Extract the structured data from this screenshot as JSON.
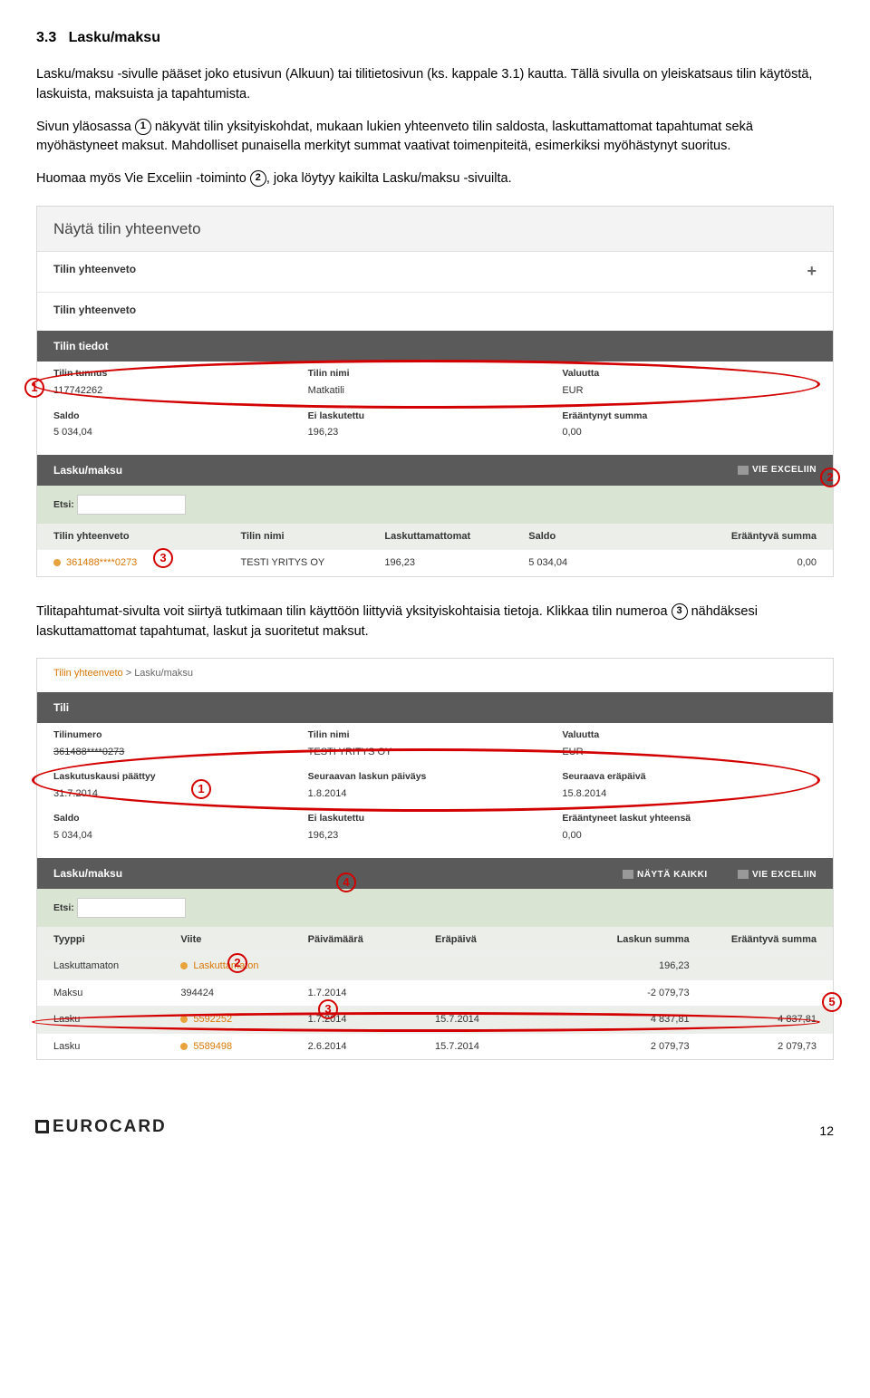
{
  "section": {
    "number": "3.3",
    "title": "Lasku/maksu"
  },
  "para1": "Lasku/maksu -sivulle pääset joko etusivun (Alkuun) tai tilitietosivun (ks. kappale 3.1) kautta. Tällä sivulla on yleiskatsaus tilin käytöstä, laskuista, maksuista ja tapahtumista.",
  "para2a": "Sivun yläosassa ",
  "para2b": " näkyvät tilin yksityiskohdat, mukaan lukien yhteenveto tilin saldosta, laskuttamattomat tapahtumat sekä myöhästyneet maksut. Mahdolliset punaisella merkityt summat vaativat toimenpiteitä, esimerkiksi myöhästynyt suoritus.",
  "para3a": "Huomaa myös Vie Exceliin -toiminto ",
  "para3b": ", joka löytyy kaikilta Lasku/maksu -sivuilta.",
  "panel1": {
    "title": "Näytä tilin yhteenveto",
    "sub1": "Tilin yhteenveto",
    "sub2": "Tilin yhteenveto",
    "darkbar": "Tilin tiedot",
    "r1": {
      "c1l": "Tilin tunnus",
      "c1v": "117742262",
      "c2l": "Tilin nimi",
      "c2v": "Matkatili",
      "c3l": "Valuutta",
      "c3v": "EUR"
    },
    "r2": {
      "c1l": "Saldo",
      "c1v": "5 034,04",
      "c2l": "Ei laskutettu",
      "c2v": "196,23",
      "c3l": "Erääntynyt summa",
      "c3v": "0,00"
    },
    "darkbar2": "Lasku/maksu",
    "vie": "VIE EXCELIIN",
    "etsi": "Etsi:",
    "thead": [
      "Tilin yhteenveto",
      "Tilin nimi",
      "Laskuttamattomat",
      "Saldo",
      "Erääntyvä summa"
    ],
    "drow": [
      "361488****0273",
      "TESTI YRITYS OY",
      "196,23",
      "5 034,04",
      "0,00"
    ]
  },
  "para4a": "Tilitapahtumat-sivulta voit siirtyä tutkimaan tilin käyttöön liittyviä yksityiskohtaisia tietoja. Klikkaa tilin numeroa ",
  "para4b": " nähdäksesi laskuttamattomat tapahtumat, laskut ja suoritetut maksut.",
  "panel2": {
    "bc1": "Tilin yhteenveto",
    "bc2": "Lasku/maksu",
    "darkbar": "Tili",
    "r1": {
      "c1l": "Tilinumero",
      "c1v": "361488****0273",
      "c2l": "Tilin nimi",
      "c2v": "TESTI YRITYS OY",
      "c3l": "Valuutta",
      "c3v": "EUR"
    },
    "r2": {
      "c1l": "Laskutuskausi päättyy",
      "c1v": "31.7.2014",
      "c2l": "Seuraavan laskun päiväys",
      "c2v": "1.8.2014",
      "c3l": "Seuraava eräpäivä",
      "c3v": "15.8.2014"
    },
    "r3": {
      "c1l": "Saldo",
      "c1v": "5 034,04",
      "c2l": "Ei laskutettu",
      "c2v": "196,23",
      "c3l": "Erääntyneet laskut yhteensä",
      "c3v": "0,00"
    },
    "darkbar2": "Lasku/maksu",
    "nayta": "NÄYTÄ KAIKKI",
    "vie": "VIE EXCELIIN",
    "etsi": "Etsi:",
    "thead": [
      "Tyyppi",
      "Viite",
      "Päivämäärä",
      "Eräpäivä",
      "Laskun summa",
      "Erääntyvä summa"
    ],
    "rows": [
      [
        "Laskuttamaton",
        "Laskuttamaton",
        "",
        "",
        "196,23",
        ""
      ],
      [
        "Maksu",
        "394424",
        "1.7.2014",
        "",
        "-2 079,73",
        ""
      ],
      [
        "Lasku",
        "5592252",
        "1.7.2014",
        "15.7.2014",
        "4 837,81",
        "4 837,81"
      ],
      [
        "Lasku",
        "5589498",
        "2.6.2014",
        "15.7.2014",
        "2 079,73",
        "2 079,73"
      ]
    ]
  },
  "footer": {
    "logo": "EUROCARD",
    "page": "12"
  },
  "nums": {
    "n1": "1",
    "n2": "2",
    "n3": "3",
    "n4": "4",
    "n5": "5"
  }
}
